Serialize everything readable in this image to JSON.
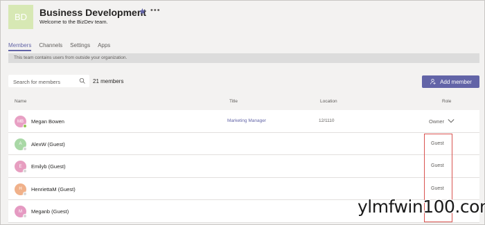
{
  "team": {
    "initials": "BD",
    "name": "Business Development",
    "description": "Welcome to the BizDev team."
  },
  "tabs": [
    {
      "label": "Members",
      "active": true
    },
    {
      "label": "Channels",
      "active": false
    },
    {
      "label": "Settings",
      "active": false
    },
    {
      "label": "Apps",
      "active": false
    }
  ],
  "banner": "This team contains users from outside your organization.",
  "search": {
    "placeholder": "Search for members",
    "value": ""
  },
  "member_count": "21 members",
  "add_member_label": "Add member",
  "columns": {
    "name": "Name",
    "title": "Title",
    "location": "Location",
    "role": "Role"
  },
  "members": [
    {
      "initials": "MB",
      "name": "Megan Bowen",
      "title": "Marketing Manager",
      "location": "12/1110",
      "role": "Owner",
      "avatar_color": "#e8a0c4",
      "presence_color": "#92c353"
    },
    {
      "initials": "A",
      "name": "AlexW (Guest)",
      "title": "",
      "location": "",
      "role": "Guest",
      "avatar_color": "#a9d8a6",
      "presence_color": "#d8d8d8"
    },
    {
      "initials": "E",
      "name": "Emilyb (Guest)",
      "title": "",
      "location": "",
      "role": "Guest",
      "avatar_color": "#e79ec0",
      "presence_color": "#d8d8d8"
    },
    {
      "initials": "H",
      "name": "HenriettaM (Guest)",
      "title": "",
      "location": "",
      "role": "Guest",
      "avatar_color": "#f0b18a",
      "presence_color": "#d8d8d8"
    },
    {
      "initials": "M",
      "name": "Meganb (Guest)",
      "title": "",
      "location": "",
      "role": "",
      "avatar_color": "#e59ac2",
      "presence_color": "#d8d8d8"
    }
  ],
  "watermark": "ylmfwin100.com",
  "colors": {
    "accent": "#6264a7",
    "highlight_box": "#d9534f"
  }
}
